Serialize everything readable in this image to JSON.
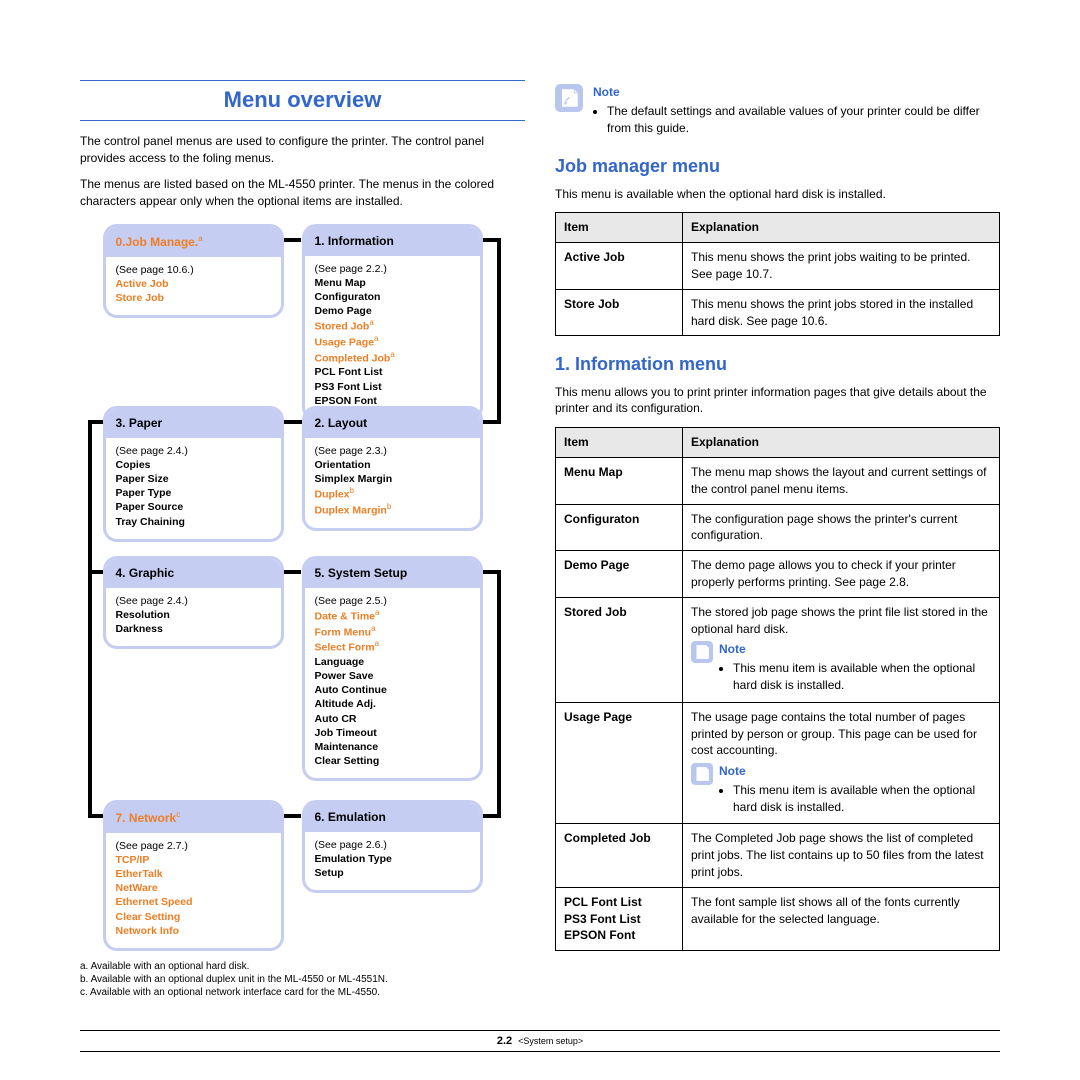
{
  "left": {
    "title": "Menu overview",
    "intro1": "The control panel menus are used to configure the printer. The control panel provides access to the foling menus.",
    "intro2": "The menus are listed based on the ML-4550 printer. The menus in the colored characters appear only when the optional items are installed.",
    "boxes": {
      "job_manage": {
        "hd": "0.Job Manage.",
        "hd_sup": "a",
        "ref": "(See page 10.6.)",
        "items": [
          "Active Job",
          "Store Job"
        ]
      },
      "information": {
        "hd": "1. Information",
        "ref": "(See page 2.2.)",
        "items_plain": [
          "Menu Map",
          "Configuraton",
          "Demo Page"
        ],
        "items_orange": [
          "Stored Job",
          "Usage Page",
          "Completed Job"
        ],
        "sup": "a",
        "items_after": [
          "PCL Font List",
          "PS3 Font List",
          "EPSON Font"
        ]
      },
      "paper": {
        "hd": "3. Paper",
        "ref": "(See page 2.4.)",
        "items": [
          "Copies",
          "Paper Size",
          "Paper Type",
          "Paper Source",
          "Tray Chaining"
        ]
      },
      "layout": {
        "hd": "2. Layout",
        "ref": "(See page 2.3.)",
        "items_plain": [
          "Orientation",
          "Simplex Margin"
        ],
        "items_orange": [
          "Duplex",
          "Duplex Margin"
        ],
        "sup": "b"
      },
      "graphic": {
        "hd": "4. Graphic",
        "ref": "(See page 2.4.)",
        "items": [
          "Resolution",
          "Darkness"
        ]
      },
      "system": {
        "hd": "5. System Setup",
        "ref": "(See page 2.5.)",
        "items_orange": [
          "Date & Time",
          "Form Menu",
          "Select Form"
        ],
        "sup": "a",
        "items_after": [
          "Language",
          "Power Save",
          "Auto Continue",
          "Altitude Adj.",
          "Auto CR",
          "Job Timeout",
          "Maintenance",
          "Clear Setting"
        ]
      },
      "network": {
        "hd": "7. Network",
        "hd_sup": "c",
        "ref": "(See page 2.7.)",
        "items": [
          "TCP/IP",
          "EtherTalk",
          "NetWare",
          "Ethernet Speed",
          "Clear Setting",
          "Network Info"
        ]
      },
      "emulation": {
        "hd": "6. Emulation",
        "ref": "(See page 2.6.)",
        "items": [
          "Emulation Type",
          "Setup"
        ]
      }
    },
    "footnotes": {
      "a": "a. Available with an optional hard disk.",
      "b": "b. Available with an optional duplex unit in the ML-4550 or ML-4551N.",
      "c": "c. Available with an optional network interface card for the ML-4550."
    }
  },
  "right": {
    "note_top_label": "Note",
    "note_top_text": "The default settings and available values of your printer could be differ from this guide.",
    "job_manager": {
      "hd": "Job manager menu",
      "intro": "This menu is available when the optional hard disk is installed.",
      "th_item": "Item",
      "th_exp": "Explanation",
      "rows": [
        {
          "item": "Active Job",
          "exp": "This menu shows the print jobs waiting to be printed. See page 10.7."
        },
        {
          "item": "Store Job",
          "exp": "This menu shows the print jobs stored in the installed hard disk. See page 10.6."
        }
      ]
    },
    "info_menu": {
      "hd": "1. Information menu",
      "intro": "This menu allows you to print printer information pages that give details about the printer and its configuration.",
      "th_item": "Item",
      "th_exp": "Explanation",
      "rows": [
        {
          "item": "Menu Map",
          "exp": "The menu map shows the layout and current settings of the control panel menu items."
        },
        {
          "item": "Configuraton",
          "exp": "The configuration page shows the printer's current configuration."
        },
        {
          "item": "Demo Page",
          "exp": "The demo page allows you to check if your printer properly performs printing. See page 2.8."
        },
        {
          "item": "Stored Job",
          "exp": "The stored job page shows the print file list stored in the optional hard disk.",
          "note": "This menu item is available when the optional hard disk is installed."
        },
        {
          "item": "Usage Page",
          "exp": "The usage page contains the total number of pages printed by person or group. This page can be used for cost accounting.",
          "note": "This menu item is available when the optional hard disk is installed."
        },
        {
          "item": "Completed Job",
          "exp": "The Completed Job page shows the list of completed print jobs. The list contains up to 50 files from the latest print jobs."
        },
        {
          "item": "PCL Font List\nPS3 Font List\nEPSON Font",
          "exp": "The font sample list shows all of the fonts currently available for the selected language."
        }
      ],
      "note_label": "Note"
    }
  },
  "footer": {
    "page": "2.2",
    "section": "<System setup>"
  }
}
